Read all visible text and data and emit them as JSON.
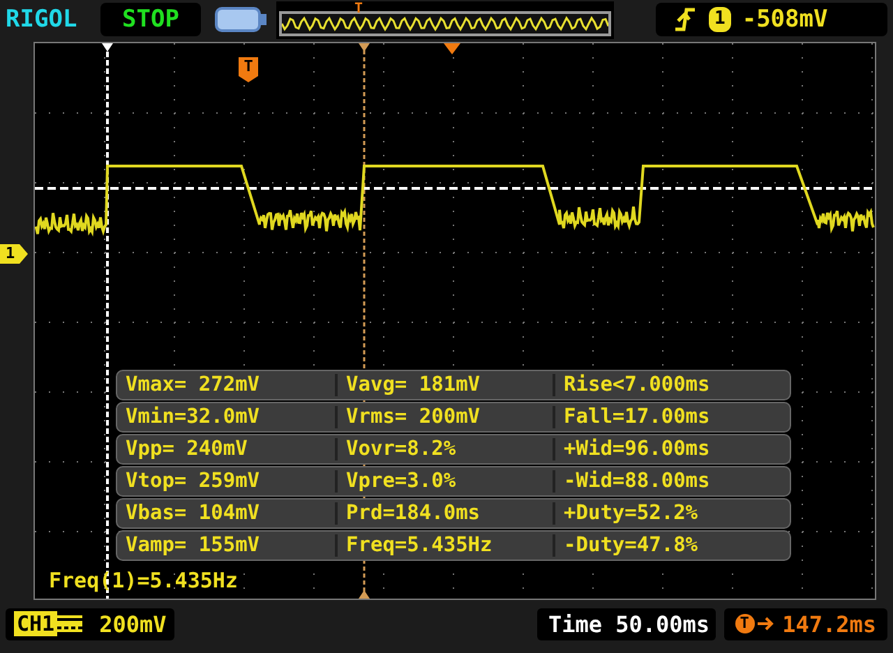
{
  "header": {
    "brand": "RIGOL",
    "run_state": "STOP",
    "overview_marker": "T",
    "trigger": {
      "source": "1",
      "level": "-508mV"
    }
  },
  "screen": {
    "trigger_marker": "T",
    "channel_marker": "1",
    "measurements": [
      [
        "Vmax= 272mV",
        "Vavg= 181mV",
        "Rise<7.000ms"
      ],
      [
        "Vmin=32.0mV",
        "Vrms= 200mV",
        "Fall=17.00ms"
      ],
      [
        "Vpp= 240mV",
        "Vovr=8.2%",
        "+Wid=96.00ms"
      ],
      [
        "Vtop= 259mV",
        "Vpre=3.0%",
        "-Wid=88.00ms"
      ],
      [
        "Vbas= 104mV",
        "Prd=184.0ms",
        "+Duty=52.2%"
      ],
      [
        "Vamp= 155mV",
        "Freq=5.435Hz",
        "-Duty=47.8%"
      ]
    ],
    "readout": "Freq(1)=5.435Hz"
  },
  "footer": {
    "channel": "CH1",
    "scale": "200mV",
    "timebase": "Time 50.00ms",
    "offset_marker": "T",
    "offset": "147.2ms"
  }
}
